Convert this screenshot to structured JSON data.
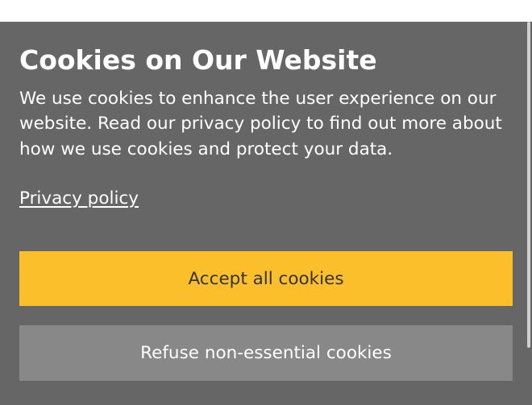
{
  "banner": {
    "title": "Cookies on Our Website",
    "body": "We use cookies to enhance the user experience on our website. Read our privacy policy to find out more about how we use cookies and protect your data.",
    "privacy_link": "Privacy policy"
  },
  "buttons": {
    "accept": "Accept all cookies",
    "refuse": "Refuse non-essential cookies"
  },
  "colors": {
    "banner_background": "#666666",
    "accept_button": "#fbbf2b",
    "refuse_button": "#888888"
  }
}
